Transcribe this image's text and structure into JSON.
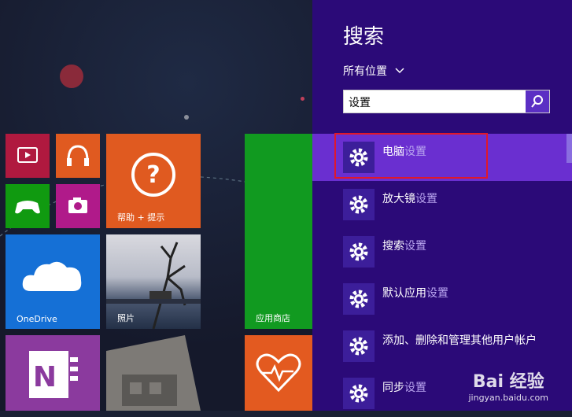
{
  "charm": {
    "title": "搜索",
    "scope_label": "所有位置",
    "search_value": "设置"
  },
  "results": [
    {
      "prefix": "电脑",
      "suffix": "设置",
      "selected": true
    },
    {
      "prefix": "放大镜",
      "suffix": "设置"
    },
    {
      "prefix": "搜索",
      "suffix": "设置"
    },
    {
      "prefix": "默认应用",
      "suffix": "设置"
    },
    {
      "prefix": "添加、删除和管理其他用户帐户",
      "suffix": ""
    },
    {
      "prefix": "同步",
      "suffix": "设置"
    }
  ],
  "tiles": {
    "help_label": "帮助 + 提示",
    "onedrive_label": "OneDrive",
    "photos_label": "照片",
    "store_label": "应用商店"
  },
  "watermark": {
    "brand": "Bai 经验",
    "url": "jingyan.baidu.com"
  },
  "colors": {
    "charm_bg": "#2b0a78",
    "selected_bg": "#6a2fd0",
    "highlight_border": "#e0182a"
  }
}
